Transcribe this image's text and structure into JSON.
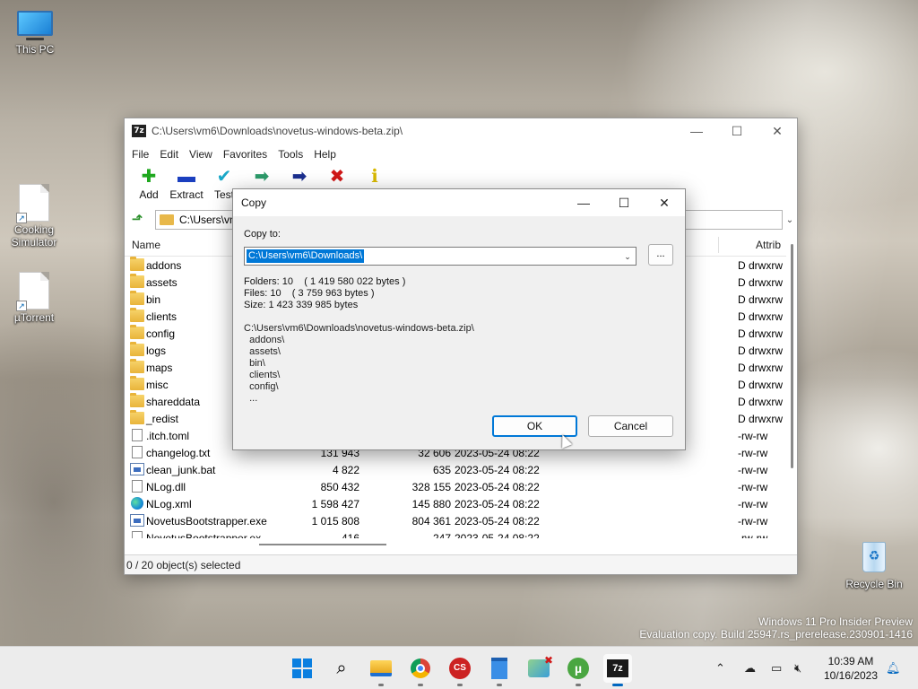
{
  "desktop": {
    "icons": [
      {
        "label": "This PC"
      },
      {
        "label": "Cooking Simulator"
      },
      {
        "label": "µTorrent"
      },
      {
        "label": "Recycle Bin"
      }
    ],
    "watermark": {
      "line1": "Windows 11 Pro Insider Preview",
      "line2": "Evaluation copy. Build 25947.rs_prerelease.230901-1416"
    }
  },
  "window": {
    "title": "C:\\Users\\vm6\\Downloads\\novetus-windows-beta.zip\\",
    "app_icon": "7z",
    "menu": [
      "File",
      "Edit",
      "View",
      "Favorites",
      "Tools",
      "Help"
    ],
    "toolbar": [
      {
        "label": "Add",
        "icon": "plus-icon",
        "glyph": "✚",
        "color": "#1fa81f"
      },
      {
        "label": "Extract",
        "icon": "minus-icon",
        "glyph": "▬",
        "color": "#1b3fbf"
      },
      {
        "label": "Test",
        "icon": "check-icon",
        "glyph": "✔",
        "color": "#1aa8c8"
      },
      {
        "label": "",
        "icon": "copy-arrow-icon",
        "glyph": "➡",
        "color": "#2c9a6a"
      },
      {
        "label": "",
        "icon": "move-arrow-icon",
        "glyph": "➡",
        "color": "#1b2f8f"
      },
      {
        "label": "",
        "icon": "delete-icon",
        "glyph": "✖",
        "color": "#d01818"
      },
      {
        "label": "",
        "icon": "info-icon",
        "glyph": "ℹ",
        "color": "#d8b800"
      }
    ],
    "address": "C:\\Users\\vm",
    "columns": {
      "name": "Name",
      "attributes": "Attrib"
    },
    "files": [
      {
        "name": "addons",
        "type": "folder",
        "size": "",
        "packed": "",
        "date": "",
        "attr": "D drwxrw"
      },
      {
        "name": "assets",
        "type": "folder",
        "size": "",
        "packed": "",
        "date": "",
        "attr": "D drwxrw"
      },
      {
        "name": "bin",
        "type": "folder",
        "size": "",
        "packed": "",
        "date": "",
        "attr": "D drwxrw"
      },
      {
        "name": "clients",
        "type": "folder",
        "size": "",
        "packed": "",
        "date": "",
        "attr": "D drwxrw"
      },
      {
        "name": "config",
        "type": "folder",
        "size": "",
        "packed": "",
        "date": "",
        "attr": "D drwxrw"
      },
      {
        "name": "logs",
        "type": "folder",
        "size": "",
        "packed": "",
        "date": "",
        "attr": "D drwxrw"
      },
      {
        "name": "maps",
        "type": "folder",
        "size": "",
        "packed": "",
        "date": "",
        "attr": "D drwxrw"
      },
      {
        "name": "misc",
        "type": "folder",
        "size": "",
        "packed": "",
        "date": "",
        "attr": "D drwxrw"
      },
      {
        "name": "shareddata",
        "type": "folder",
        "size": "",
        "packed": "",
        "date": "",
        "attr": "D drwxrw"
      },
      {
        "name": "_redist",
        "type": "folder",
        "size": "",
        "packed": "",
        "date": "",
        "attr": "D drwxrw"
      },
      {
        "name": ".itch.toml",
        "type": "file",
        "size": "",
        "packed": "",
        "date": "",
        "attr": "-rw-rw"
      },
      {
        "name": "changelog.txt",
        "type": "file",
        "size": "131 943",
        "packed": "32 606",
        "date": "2023-05-24 08:22",
        "attr": "-rw-rw"
      },
      {
        "name": "clean_junk.bat",
        "type": "exe",
        "size": "4 822",
        "packed": "635",
        "date": "2023-05-24 08:22",
        "attr": "-rw-rw"
      },
      {
        "name": "NLog.dll",
        "type": "file",
        "size": "850 432",
        "packed": "328 155",
        "date": "2023-05-24 08:22",
        "attr": "-rw-rw"
      },
      {
        "name": "NLog.xml",
        "type": "edge",
        "size": "1 598 427",
        "packed": "145 880",
        "date": "2023-05-24 08:22",
        "attr": "-rw-rw"
      },
      {
        "name": "NovetusBootstrapper.exe",
        "type": "exe",
        "size": "1 015 808",
        "packed": "804 361",
        "date": "2023-05-24 08:22",
        "attr": "-rw-rw"
      },
      {
        "name": "NovetusBootstrapper.ex",
        "type": "file",
        "size": "416",
        "packed": "247",
        "date": "2023-05-24 08:22",
        "attr": "-rw-rw"
      }
    ],
    "status": "0 / 20 object(s) selected"
  },
  "dialog": {
    "title": "Copy",
    "copy_to_label": "Copy to:",
    "destination": "C:\\Users\\vm6\\Downloads\\",
    "browse_label": "...",
    "folders_line": "Folders: 10    ( 1 419 580 022 bytes )",
    "files_line": "Files: 10    ( 3 759 963 bytes )",
    "size_line": "Size: 1 423 339 985 bytes",
    "source_path": "C:\\Users\\vm6\\Downloads\\novetus-windows-beta.zip\\",
    "items": [
      "  addons\\",
      "  assets\\",
      "  bin\\",
      "  clients\\",
      "  config\\",
      "  ..."
    ],
    "ok_label": "OK",
    "cancel_label": "Cancel"
  },
  "taskbar": {
    "clock_time": "10:39 AM",
    "clock_date": "10/16/2023",
    "apps": [
      "start-icon",
      "search-icon",
      "file-explorer-icon",
      "chrome-icon",
      "cs-app-icon",
      "notepad-icon",
      "paint-icon",
      "utorrent-icon",
      "7zip-icon"
    ]
  }
}
